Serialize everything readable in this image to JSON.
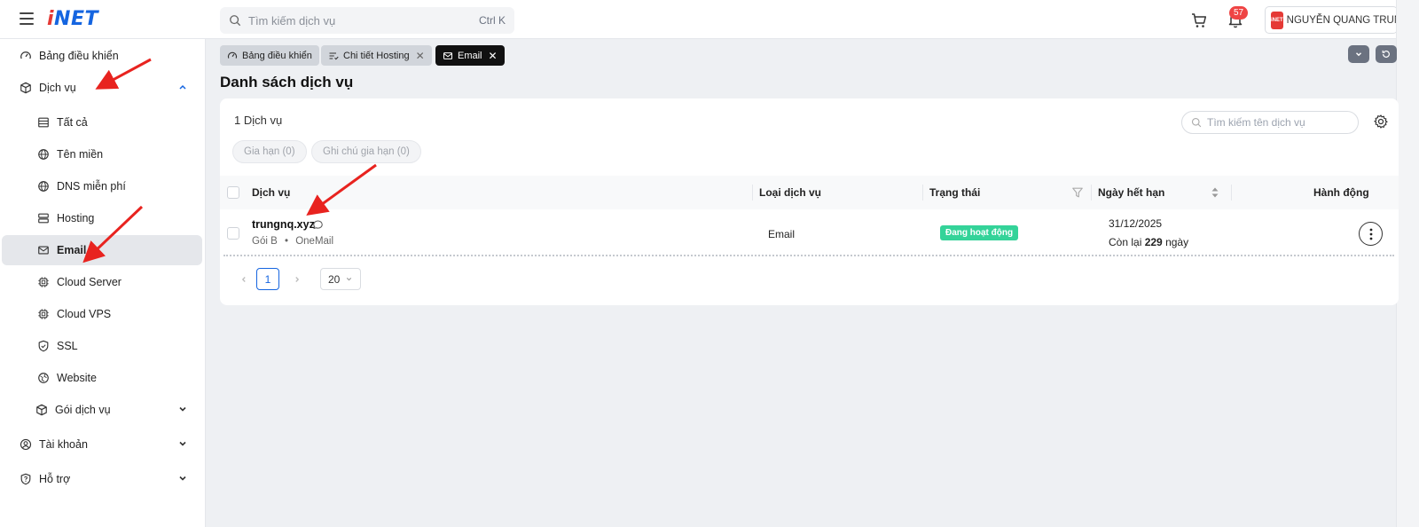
{
  "header": {
    "logo": "iNET",
    "search_placeholder": "Tìm kiếm dịch vụ",
    "search_shortcut": "Ctrl K",
    "notification_count": "57",
    "user_name": "NGUYỄN QUANG TRUNG",
    "avatar_text": "iNET"
  },
  "sidebar": {
    "items": [
      {
        "label": "Bảng điều khiển",
        "icon": "gauge-icon"
      },
      {
        "label": "Dịch vụ",
        "icon": "box-icon"
      },
      {
        "label": "Tất cả",
        "icon": "list-icon"
      },
      {
        "label": "Tên miền",
        "icon": "globe-icon"
      },
      {
        "label": "DNS miễn phí",
        "icon": "globe-icon"
      },
      {
        "label": "Hosting",
        "icon": "server-icon"
      },
      {
        "label": "Email",
        "icon": "mail-icon"
      },
      {
        "label": "Cloud Server",
        "icon": "chip-icon"
      },
      {
        "label": "Cloud VPS",
        "icon": "chip-icon"
      },
      {
        "label": "SSL",
        "icon": "shield-icon"
      },
      {
        "label": "Website",
        "icon": "web-icon"
      },
      {
        "label": "Gói dịch vụ",
        "icon": "box-icon"
      },
      {
        "label": "Tài khoản",
        "icon": "user-icon"
      },
      {
        "label": "Hỗ trợ",
        "icon": "support-icon"
      }
    ]
  },
  "tabs": [
    {
      "label": "Bảng điều khiển"
    },
    {
      "label": "Chi tiết Hosting"
    },
    {
      "label": "Email"
    }
  ],
  "page": {
    "title": "Danh sách dịch vụ"
  },
  "card": {
    "count": "1 Dịch vụ",
    "search_placeholder": "Tìm kiếm tên dịch vụ",
    "filters": [
      "Gia hạn (0)",
      "Ghi chú gia hạn (0)"
    ],
    "columns": [
      "Dịch vụ",
      "Loại dịch vụ",
      "Trạng thái",
      "Ngày hết hạn",
      "Hành động"
    ],
    "rows": [
      {
        "name": "trungnq.xyz",
        "plan": "Gói B",
        "product": "OneMail",
        "type": "Email",
        "status": "Đang hoạt động",
        "expiry": "31/12/2025",
        "remaining_prefix": "Còn lại",
        "remaining_days": "229",
        "remaining_suffix": "ngày"
      }
    ],
    "pagination": {
      "page": "1",
      "page_size": "20"
    }
  },
  "colors": {
    "accent": "#1565e0",
    "status_active": "#34d399",
    "annotation_arrow": "#e8231f",
    "logo_red": "#e53935"
  }
}
